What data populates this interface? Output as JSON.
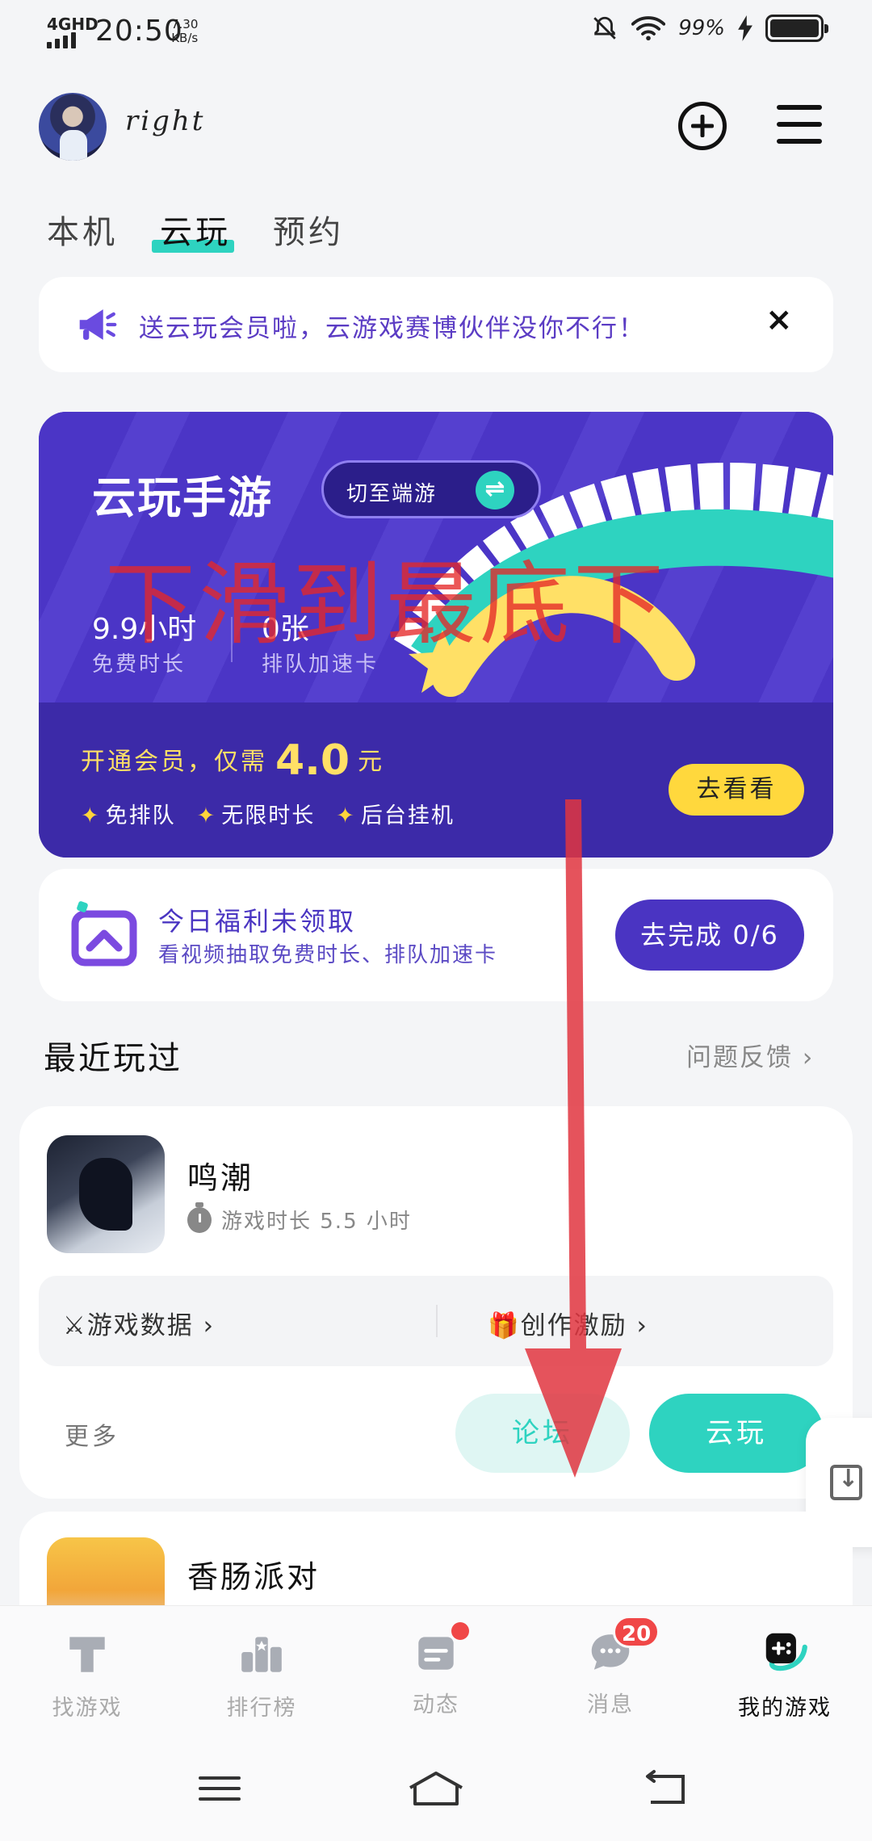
{
  "status_bar": {
    "network": "4GHD",
    "time": "20:50",
    "speed_value": "7.30",
    "speed_unit": "KB/s",
    "battery": "99%"
  },
  "header": {
    "username": "right"
  },
  "tabs": [
    {
      "label": "本机",
      "active": false
    },
    {
      "label": "云玩",
      "active": true
    },
    {
      "label": "预约",
      "active": false
    }
  ],
  "notice": {
    "text": "送云玩会员啦，云游戏赛博伙伴没你不行！",
    "close": "×"
  },
  "banner": {
    "title": "云玩手游",
    "switch_label": "切至端游",
    "switch_icon": "⇌",
    "overlay_annotation": "下滑到最底下",
    "stats": [
      {
        "value": "9.9小时",
        "label": "免费时长"
      },
      {
        "value": "0张",
        "label": "排队加速卡"
      }
    ],
    "promo_prefix": "开通会员，仅需",
    "promo_price": "4.0",
    "promo_suffix": "元",
    "perks": [
      "免排队",
      "无限时长",
      "后台挂机"
    ],
    "cta": "去看看"
  },
  "welfare": {
    "title": "今日福利未领取",
    "subtitle": "看视频抽取免费时长、排队加速卡",
    "button": "去完成 0/6"
  },
  "recent": {
    "title": "最近玩过",
    "feedback": "问题反馈 ›"
  },
  "games": [
    {
      "name": "鸣潮",
      "play_time": "游戏时长 5.5 小时",
      "links": [
        "⚔游戏数据 ›",
        "🎁创作激励 ›"
      ],
      "more": "更多",
      "forum_button": "论坛",
      "play_button": "云玩"
    },
    {
      "name": "香肠派对"
    }
  ],
  "bottom_nav": [
    {
      "label": "找游戏",
      "icon": "find-game-icon",
      "active": false
    },
    {
      "label": "排行榜",
      "icon": "ranking-icon",
      "active": false
    },
    {
      "label": "动态",
      "icon": "feed-icon",
      "active": false,
      "dot": true
    },
    {
      "label": "消息",
      "icon": "message-icon",
      "active": false,
      "badge": "20"
    },
    {
      "label": "我的游戏",
      "icon": "my-games-icon",
      "active": true
    }
  ],
  "colors": {
    "accent_teal": "#2ed3c0",
    "accent_purple": "#4a34c2",
    "promo_yellow": "#ffd83d",
    "badge_red": "#f04747"
  }
}
